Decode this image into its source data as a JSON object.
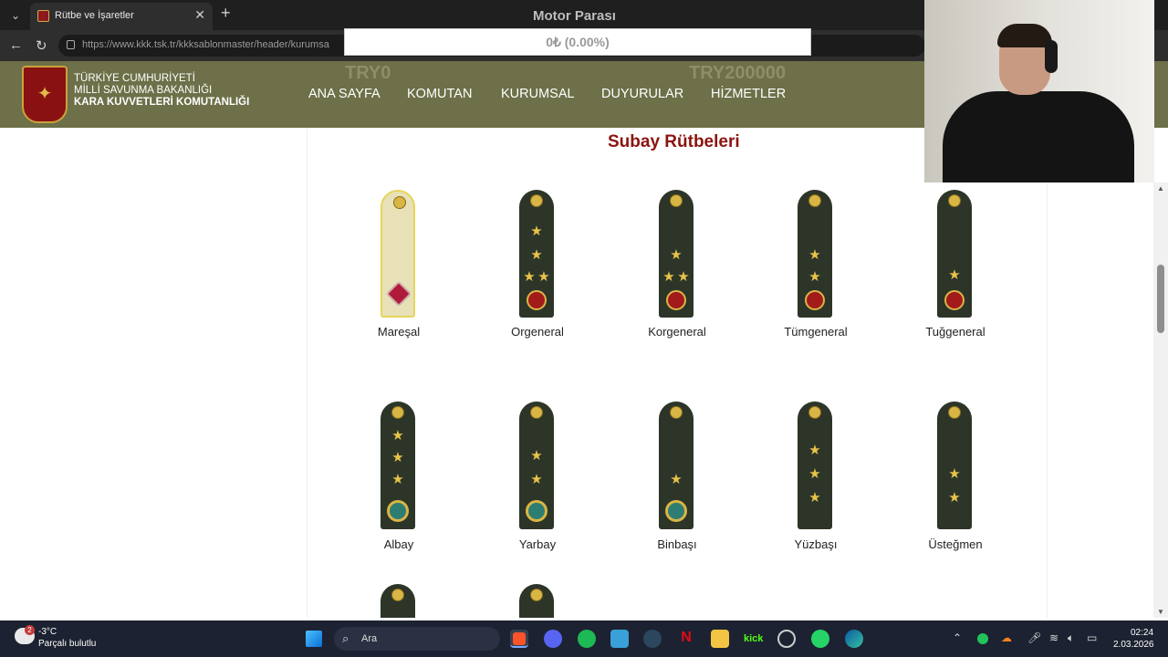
{
  "browser": {
    "tab_title": "Rütbe ve İşaretler",
    "url_host": "https://www.kkk.tsk.tr",
    "url_path": "/kkksablonmaster/header/kurumsa"
  },
  "site": {
    "org_line1": "TÜRKİYE CUMHURİYETİ",
    "org_line2": "MİLLİ SAVUNMA BAKANLIĞI",
    "org_line3": "KARA KUVVETLERİ KOMUTANLIĞI",
    "nav": [
      "ANA SAYFA",
      "KOMUTAN",
      "KURUMSAL",
      "DUYURULAR",
      "HİZMETLER"
    ]
  },
  "content": {
    "section_title": "Subay Rütbeleri",
    "ranks_row1": [
      "Mareşal",
      "Orgeneral",
      "Korgeneral",
      "Tümgeneral",
      "Tuğgeneral"
    ],
    "ranks_row2": [
      "Albay",
      "Yarbay",
      "Binbaşı",
      "Yüzbaşı",
      "Üsteğmen"
    ]
  },
  "overlay": {
    "title": "Motor Parası",
    "value": "0₺ (0.00%)",
    "min": "TRY0",
    "max": "TRY200000"
  },
  "taskbar": {
    "temperature": "-3°C",
    "condition": "Parçalı bulutlu",
    "weather_badge": "2",
    "search_placeholder": "Ara",
    "time": "02:24",
    "date": "2.03.2026"
  },
  "colors": {
    "header_bg": "#6d7048",
    "title_red": "#8b1410",
    "board_green": "#2c3528",
    "gold": "#e8c34a"
  }
}
